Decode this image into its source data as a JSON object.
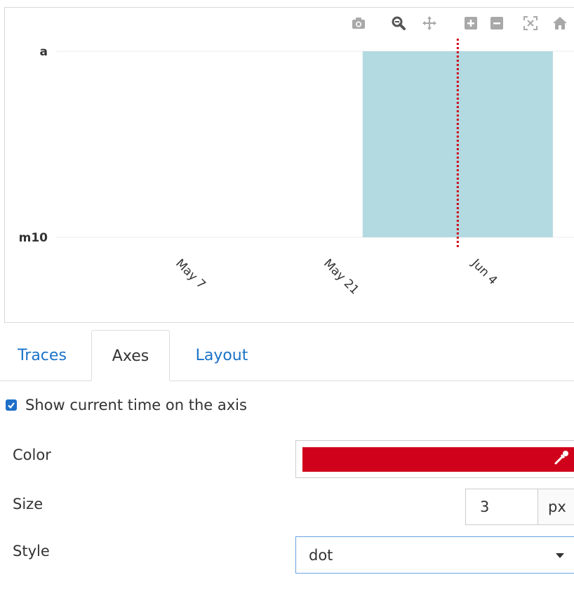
{
  "chart_data": {
    "type": "bar",
    "orientation": "horizontal",
    "title": "",
    "xlabel": "",
    "ylabel": "",
    "y_categories": [
      "a",
      "m10"
    ],
    "x_axis_type": "date",
    "x_tick_labels": [
      "May 7",
      "May 21",
      "Jun 4"
    ],
    "x_tick_dates": [
      "2023-05-07",
      "2023-05-21",
      "2023-06-04"
    ],
    "x_range": [
      "2023-04-24",
      "2023-06-12"
    ],
    "bar": {
      "x_start": "2023-05-23",
      "x_end": "2023-06-10",
      "y_from": "m10",
      "y_to": "a",
      "color": "#b3dae0"
    },
    "current_time_line": {
      "x": "2023-06-01",
      "color": "#d0021b",
      "style": "dot",
      "width": 3
    },
    "grid": true,
    "legend": "none"
  },
  "modebar": {
    "icons": [
      "camera-icon",
      "zoom-icon",
      "pan-icon",
      "zoom-in-icon",
      "zoom-out-icon",
      "autoscale-icon",
      "home-icon"
    ]
  },
  "tabs": [
    {
      "label": "Traces",
      "active": false
    },
    {
      "label": "Axes",
      "active": true
    },
    {
      "label": "Layout",
      "active": false
    }
  ],
  "settings": {
    "show_current_time": {
      "label": "Show current time on the axis",
      "checked": true
    },
    "color": {
      "label": "Color",
      "value": "#d0021b"
    },
    "size": {
      "label": "Size",
      "value": "3",
      "unit": "px"
    },
    "style": {
      "label": "Style",
      "value": "dot"
    }
  }
}
